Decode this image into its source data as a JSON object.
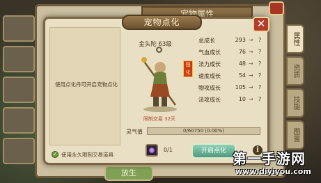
{
  "background_panel": {
    "title": "宠物属性",
    "side_tabs": [
      "属性",
      "资质",
      "技能",
      "图鉴"
    ],
    "bottom_button": "放生"
  },
  "dialog": {
    "title": "宠物点化",
    "close_label": "✕",
    "info_text": "使用点化丹可开启宠物点化",
    "checkbox_label": "使用永久限制交易道具",
    "pet_name": "金头陀 63级",
    "pet_badge": "强化",
    "trade_limit": "限制交易 32天",
    "stats": [
      {
        "label": "总成长",
        "value": "293",
        "arrow": "→",
        "target": "?"
      },
      {
        "label": "气血成长",
        "value": "76",
        "arrow": "→",
        "target": "?"
      },
      {
        "label": "法力成长",
        "value": "48",
        "arrow": "→",
        "target": "?"
      },
      {
        "label": "速度成长",
        "value": "54",
        "arrow": "→",
        "target": "?"
      },
      {
        "label": "物攻成长",
        "value": "105",
        "arrow": "→",
        "target": "?"
      },
      {
        "label": "法攻成长",
        "value": "10",
        "arrow": "→",
        "target": "?"
      }
    ],
    "exp_label": "灵气值",
    "exp_text": "0/60750 (0.00%)",
    "exp_fraction": 0.0,
    "item_count": "0/1",
    "activate_button": "开启点化",
    "info_icon_label": "i"
  },
  "watermark": {
    "title": "第一手游网",
    "url": "www.diyiyou.com"
  }
}
